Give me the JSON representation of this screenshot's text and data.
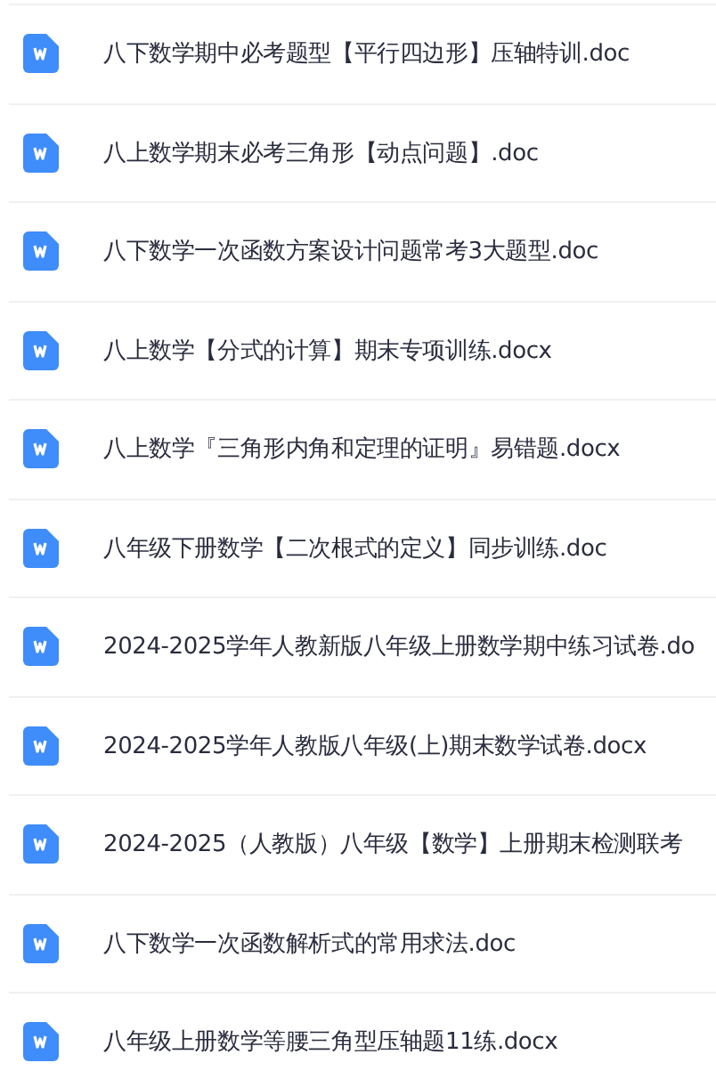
{
  "files": [
    {
      "name": "八下数学期中必考题型【平行四边形】压轴特训.doc"
    },
    {
      "name": "八上数学期末必考三角形【动点问题】.doc"
    },
    {
      "name": "八下数学一次函数方案设计问题常考3大题型.doc"
    },
    {
      "name": "八上数学【分式的计算】期末专项训练.docx"
    },
    {
      "name": "八上数学『三角形内角和定理的证明』易错题.docx"
    },
    {
      "name": "八年级下册数学【二次根式的定义】同步训练.doc"
    },
    {
      "name": "2024-2025学年人教新版八年级上册数学期中练习试卷.do"
    },
    {
      "name": "2024-2025学年人教版八年级(上)期末数学试卷.docx"
    },
    {
      "name": "2024-2025（人教版）八年级【数学】上册期末检测联考"
    },
    {
      "name": "八下数学一次函数解析式的常用求法.doc"
    },
    {
      "name": "八年级上册数学等腰三角型压轴题11练.docx"
    }
  ]
}
